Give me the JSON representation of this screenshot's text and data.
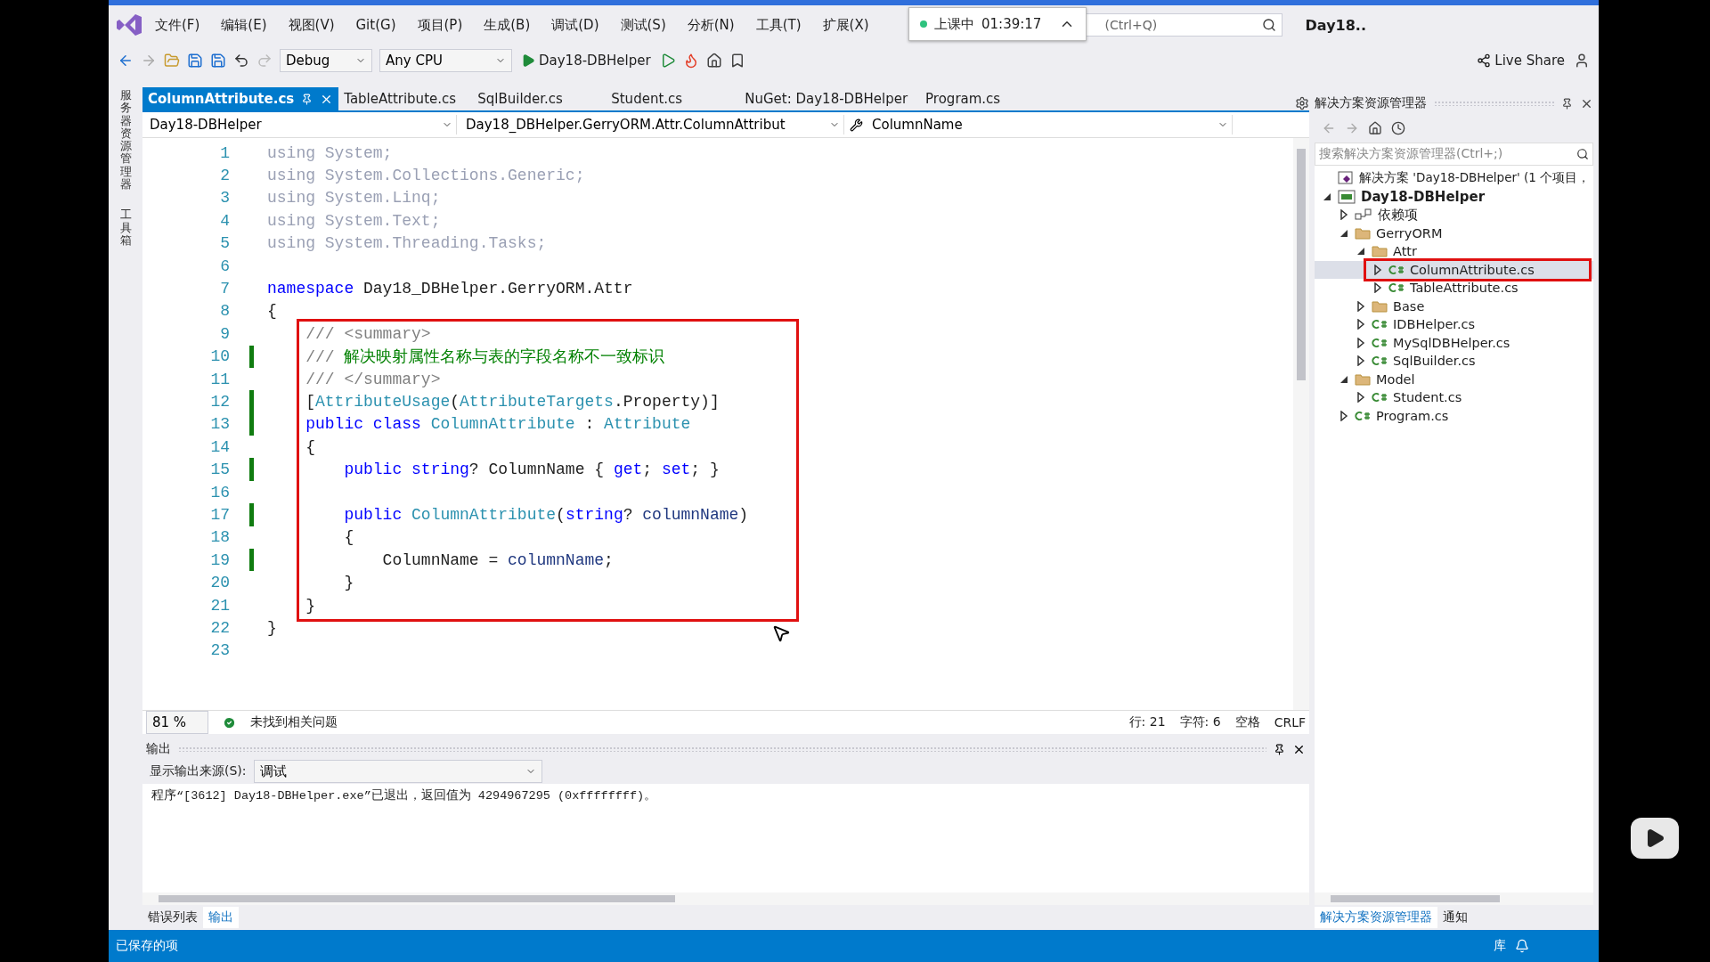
{
  "menu_bar": {
    "items": [
      "文件(F)",
      "编辑(E)",
      "视图(V)",
      "Git(G)",
      "项目(P)",
      "生成(B)",
      "调试(D)",
      "测试(S)",
      "分析(N)",
      "工具(T)",
      "扩展(X)"
    ],
    "search": {
      "placeholder": "(Ctrl+Q)"
    },
    "title": "Day18..",
    "timer_popup": {
      "status": "上课中",
      "time": "01:39:17"
    }
  },
  "toolbar": {
    "configuration": "Debug",
    "platform": "Any CPU",
    "start_target": "Day18-DBHelper",
    "live_share": "Live Share"
  },
  "side_strip": [
    "服务器资源管理器",
    "工具箱"
  ],
  "document_tabs": [
    {
      "label": "ColumnAttribute.cs",
      "selected": true
    },
    {
      "label": "TableAttribute.cs",
      "selected": false
    },
    {
      "label": "SqlBuilder.cs",
      "selected": false
    },
    {
      "label": "Student.cs",
      "selected": false
    },
    {
      "label": "NuGet: Day18-DBHelper",
      "selected": false
    },
    {
      "label": "Program.cs",
      "selected": false
    }
  ],
  "nav_bar": {
    "project": "Day18-DBHelper",
    "type": "Day18_DBHelper.GerryORM.Attr.ColumnAttribut",
    "member": "ColumnName"
  },
  "code_blocks": [
    {
      "boxed": false,
      "lines": [
        {
          "number": "1",
          "changed": false,
          "tokens": [
            {
              "kind": "faded",
              "text": "using System;"
            }
          ]
        },
        {
          "number": "2",
          "changed": false,
          "tokens": [
            {
              "kind": "faded",
              "text": "using System.Collections.Generic;"
            }
          ]
        },
        {
          "number": "3",
          "changed": false,
          "tokens": [
            {
              "kind": "faded",
              "text": "using System.Linq;"
            }
          ]
        },
        {
          "number": "4",
          "changed": false,
          "tokens": [
            {
              "kind": "faded",
              "text": "using System.Text;"
            }
          ]
        },
        {
          "number": "5",
          "changed": false,
          "tokens": [
            {
              "kind": "faded",
              "text": "using System.Threading.Tasks;"
            }
          ]
        },
        {
          "number": "6",
          "changed": false
        },
        {
          "number": "7",
          "changed": false,
          "tokens": [
            {
              "kind": "keyword",
              "text": "namespace"
            },
            {
              "kind": "plain",
              "text": " Day18_DBHelper.GerryORM.Attr"
            }
          ]
        },
        {
          "number": "8",
          "changed": false,
          "tokens": [
            {
              "kind": "plain",
              "text": "{"
            }
          ]
        }
      ]
    },
    {
      "boxed": true,
      "lines": [
        {
          "number": "9",
          "changed": false,
          "tokens": [
            {
              "kind": "doc",
              "text": "    /// <summary>"
            }
          ]
        },
        {
          "number": "10",
          "changed": true,
          "tokens": [
            {
              "kind": "doc",
              "text": "    /// "
            },
            {
              "kind": "comment",
              "text": "解决映射属性名称与表的字段名称不一致标识"
            }
          ]
        },
        {
          "number": "11",
          "changed": false,
          "tokens": [
            {
              "kind": "doc",
              "text": "    /// </summary>"
            }
          ]
        },
        {
          "number": "12",
          "changed": true,
          "tokens": [
            {
              "kind": "plain",
              "text": "    ["
            },
            {
              "kind": "type",
              "text": "AttributeUsage"
            },
            {
              "kind": "plain",
              "text": "("
            },
            {
              "kind": "type",
              "text": "AttributeTargets"
            },
            {
              "kind": "plain",
              "text": ".Property)]"
            }
          ]
        },
        {
          "number": "13",
          "changed": true,
          "tokens": [
            {
              "kind": "keyword",
              "text": "    public class "
            },
            {
              "kind": "type",
              "text": "ColumnAttribute"
            },
            {
              "kind": "plain",
              "text": " : "
            },
            {
              "kind": "type",
              "text": "Attribute"
            }
          ]
        },
        {
          "number": "14",
          "changed": false,
          "tokens": [
            {
              "kind": "plain",
              "text": "    {"
            }
          ]
        },
        {
          "number": "15",
          "changed": true,
          "tokens": [
            {
              "kind": "keyword",
              "text": "        public string"
            },
            {
              "kind": "plain",
              "text": "? ColumnName { "
            },
            {
              "kind": "keyword",
              "text": "get"
            },
            {
              "kind": "plain",
              "text": "; "
            },
            {
              "kind": "keyword",
              "text": "set"
            },
            {
              "kind": "plain",
              "text": "; }"
            }
          ]
        },
        {
          "number": "16",
          "changed": false
        },
        {
          "number": "17",
          "changed": true,
          "tokens": [
            {
              "kind": "keyword",
              "text": "        public "
            },
            {
              "kind": "type",
              "text": "ColumnAttribute"
            },
            {
              "kind": "plain",
              "text": "("
            },
            {
              "kind": "keyword",
              "text": "string"
            },
            {
              "kind": "plain",
              "text": "? "
            },
            {
              "kind": "param",
              "text": "columnName"
            },
            {
              "kind": "plain",
              "text": ")"
            }
          ]
        },
        {
          "number": "18",
          "changed": false,
          "tokens": [
            {
              "kind": "plain",
              "text": "        {"
            }
          ]
        },
        {
          "number": "19",
          "changed": true,
          "tokens": [
            {
              "kind": "plain",
              "text": "            ColumnName = "
            },
            {
              "kind": "param",
              "text": "columnName"
            },
            {
              "kind": "plain",
              "text": ";"
            }
          ]
        },
        {
          "number": "20",
          "changed": false,
          "tokens": [
            {
              "kind": "plain",
              "text": "        }"
            }
          ]
        },
        {
          "number": "21",
          "changed": false,
          "tokens": [
            {
              "kind": "plain",
              "text": "    }"
            }
          ]
        }
      ]
    },
    {
      "boxed": false,
      "lines": [
        {
          "number": "22",
          "changed": false,
          "tokens": [
            {
              "kind": "plain",
              "text": "}"
            }
          ]
        },
        {
          "number": "23",
          "changed": false
        }
      ]
    }
  ],
  "editor_status": {
    "zoom": "81 %",
    "issues": "未找到相关问题",
    "line": "行: 21",
    "char": "字符: 6",
    "whitespace": "空格",
    "line_ending": "CRLF"
  },
  "output": {
    "title": "输出",
    "source_label": "显示输出来源(S):",
    "source": "调试",
    "text": "程序“[3612] Day18-DBHelper.exe”已退出，返回值为 4294967295 (0xffffffff)。"
  },
  "bottom_tabs": [
    {
      "label": "错误列表",
      "selected": false
    },
    {
      "label": "输出",
      "selected": true
    }
  ],
  "solution_explorer": {
    "title": "解决方案资源管理器",
    "search": {
      "placeholder": "搜索解决方案资源管理器(Ctrl+;)"
    },
    "tree": [
      {
        "kind": "solution",
        "label": "解决方案 'Day18-DBHelper' (1 个项目，",
        "children": [
          {
            "kind": "project",
            "label": "Day18-DBHelper",
            "expanded": true,
            "children": [
              {
                "kind": "deps",
                "label": "依赖项",
                "expanded": false
              },
              {
                "kind": "folder",
                "label": "GerryORM",
                "expanded": true,
                "children": [
                  {
                    "kind": "folder",
                    "label": "Attr",
                    "expanded": true,
                    "children": [
                      {
                        "kind": "cs",
                        "label": "ColumnAttribute.cs",
                        "expanded": false,
                        "selected": true,
                        "highlighted": true
                      },
                      {
                        "kind": "cs",
                        "label": "TableAttribute.cs",
                        "expanded": false,
                        "selected": false,
                        "highlighted": false
                      }
                    ]
                  },
                  {
                    "kind": "folder",
                    "label": "Base",
                    "expanded": false
                  },
                  {
                    "kind": "cs",
                    "label": "IDBHelper.cs",
                    "expanded": false
                  },
                  {
                    "kind": "cs",
                    "label": "MySqlDBHelper.cs",
                    "expanded": false
                  },
                  {
                    "kind": "cs",
                    "label": "SqlBuilder.cs",
                    "expanded": false
                  }
                ]
              },
              {
                "kind": "folder",
                "label": "Model",
                "expanded": true,
                "children": [
                  {
                    "kind": "cs",
                    "label": "Student.cs",
                    "expanded": false
                  }
                ]
              },
              {
                "kind": "cs",
                "label": "Program.cs",
                "expanded": false
              }
            ]
          }
        ]
      }
    ],
    "tabs": [
      {
        "label": "解决方案资源管理器",
        "selected": true
      },
      {
        "label": "通知",
        "selected": false
      }
    ]
  },
  "status_bar": {
    "message": "已保存的项",
    "repo": "库"
  }
}
